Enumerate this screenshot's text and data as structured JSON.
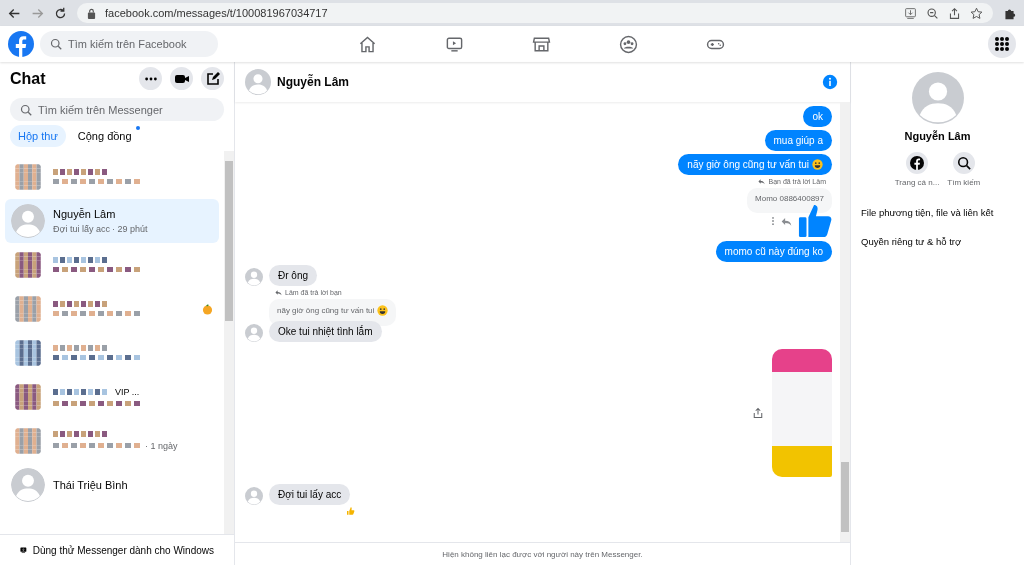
{
  "browser": {
    "url": "facebook.com/messages/t/100081967034717"
  },
  "topbar": {
    "search": {
      "placeholder": "Tìm kiếm trên Facebook"
    }
  },
  "sidebar": {
    "title": "Chat",
    "search": {
      "placeholder": "Tìm kiếm trên Messenger"
    },
    "tabs": [
      {
        "label": "Hộp thư",
        "selected": true,
        "unread": false
      },
      {
        "label": "Cộng đồng",
        "selected": false,
        "unread": true
      }
    ],
    "conversations": [
      {
        "kind": "blurred",
        "selected": false
      },
      {
        "kind": "contact",
        "name": "Nguyễn Lâm",
        "preview": "Đợi tui lấy acc",
        "time": "· 29 phút",
        "selected": true
      },
      {
        "kind": "blurred",
        "selected": false
      },
      {
        "kind": "blurred",
        "selected": false,
        "emoji_badge": true
      },
      {
        "kind": "blurred",
        "selected": false
      },
      {
        "kind": "blurred",
        "selected": false,
        "name_tail": "VIP ..."
      },
      {
        "kind": "blurred",
        "selected": false,
        "time": "· 1 ngày"
      },
      {
        "kind": "contact",
        "name": "Thái Triệu Bình",
        "selected": false
      }
    ],
    "footer": "Dùng thử Messenger dành cho Windows"
  },
  "chat": {
    "name": "Nguyễn Lâm",
    "messages": [
      {
        "kind": "text",
        "outgoing": true,
        "text": "ok"
      },
      {
        "kind": "text",
        "outgoing": true,
        "text": "mua giúp a"
      },
      {
        "kind": "text",
        "outgoing": true,
        "text": "nãy giờ ông cũng tư vấn tui",
        "emoji": true
      },
      {
        "kind": "like_reply",
        "outgoing": true,
        "reply_label": "Bạn đã trả lời Lâm",
        "quote": "Momo 0886400897"
      },
      {
        "kind": "text",
        "outgoing": true,
        "text": "momo cũ này đúng ko"
      },
      {
        "kind": "text",
        "outgoing": false,
        "text": "Đr ông"
      },
      {
        "kind": "reply",
        "outgoing": false,
        "reply_label": "Lâm đã trả lời bạn",
        "quote": "nãy giờ ông cũng tư vấn tui",
        "quote_emoji": true,
        "text": "Oke tui nhiệt tình lắm"
      },
      {
        "kind": "image",
        "outgoing": true
      },
      {
        "kind": "text",
        "outgoing": false,
        "text": "Đợi tui lấy acc",
        "reacted": true
      }
    ],
    "notice": "Hiện không liên lạc được với người này trên Messenger."
  },
  "profile": {
    "name": "Nguyễn Lâm",
    "actions": [
      {
        "kind": "facebook",
        "label": "Trang cá n..."
      },
      {
        "kind": "search",
        "label": "Tìm kiếm"
      }
    ],
    "menu": [
      "File phương tiện, file và liên kết",
      "Quyền riêng tư & hỗ trợ"
    ]
  }
}
